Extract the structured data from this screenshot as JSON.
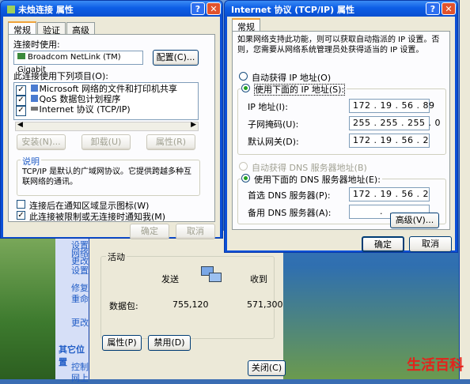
{
  "win1": {
    "title": "未烛连接 属性",
    "tabs": [
      "常规",
      "验证",
      "高级"
    ],
    "connect_using_label": "连接时使用:",
    "adapter": "Broadcom NetLink (TM) Gigabit",
    "configure_btn": "配置(C)...",
    "items_label": "此连接使用下列项目(O):",
    "items": [
      {
        "label": "Microsoft 网络的文件和打印机共享"
      },
      {
        "label": "QoS 数据包计划程序"
      },
      {
        "label": "Internet 协议 (TCP/IP)"
      }
    ],
    "install_btn": "安装(N)...",
    "uninstall_btn": "卸载(U)",
    "properties_btn": "属性(R)",
    "desc_legend": "说明",
    "desc_text": "TCP/IP 是默认的广域网协议。它提供跨越多种互联网络的通讯。",
    "cb1": "连接后在通知区域显示图标(W)",
    "cb2": "此连接被限制或无连接时通知我(M)",
    "ok_btn": "确定",
    "cancel_btn": "取消"
  },
  "win2": {
    "title": "Internet 协议 (TCP/IP) 属性",
    "tab": "常规",
    "intro": "如果网络支持此功能，则可以获取自动指派的 IP 设置。否则，您需要从网络系统管理员处获得适当的 IP 设置。",
    "auto_ip": "自动获得 IP 地址(O)",
    "use_ip": "使用下面的 IP 地址(S):",
    "ip_label": "IP 地址(I):",
    "ip_value": "172 . 19 . 56 . 89",
    "mask_label": "子网掩码(U):",
    "mask_value": "255 . 255 . 255 . 0",
    "gw_label": "默认网关(D):",
    "gw_value": "172 . 19 . 56 . 2",
    "auto_dns": "自动获得 DNS 服务器地址(B)",
    "use_dns": "使用下面的 DNS 服务器地址(E):",
    "dns1_label": "首选 DNS 服务器(P):",
    "dns1_value": "172 . 19 . 56 . 2",
    "dns2_label": "备用 DNS 服务器(A):",
    "dns2_value": " .  .  . ",
    "advanced_btn": "高级(V)...",
    "ok_btn": "确定",
    "cancel_btn": "取消"
  },
  "status": {
    "activity_legend": "活动",
    "sent_label": "发送",
    "received_label": "收到",
    "packets_label": "数据包:",
    "sent_value": "755,120",
    "received_value": "571,300",
    "properties_btn": "属性(P)",
    "disable_btn": "禁用(D)",
    "close_btn": "关闭(C)"
  },
  "sidebar": {
    "items": [
      "设置",
      "网络",
      "更改",
      "设置",
      "修复",
      "重命",
      "更改",
      "其它位置",
      "控制",
      "网上"
    ]
  },
  "watermark": "生活百科"
}
